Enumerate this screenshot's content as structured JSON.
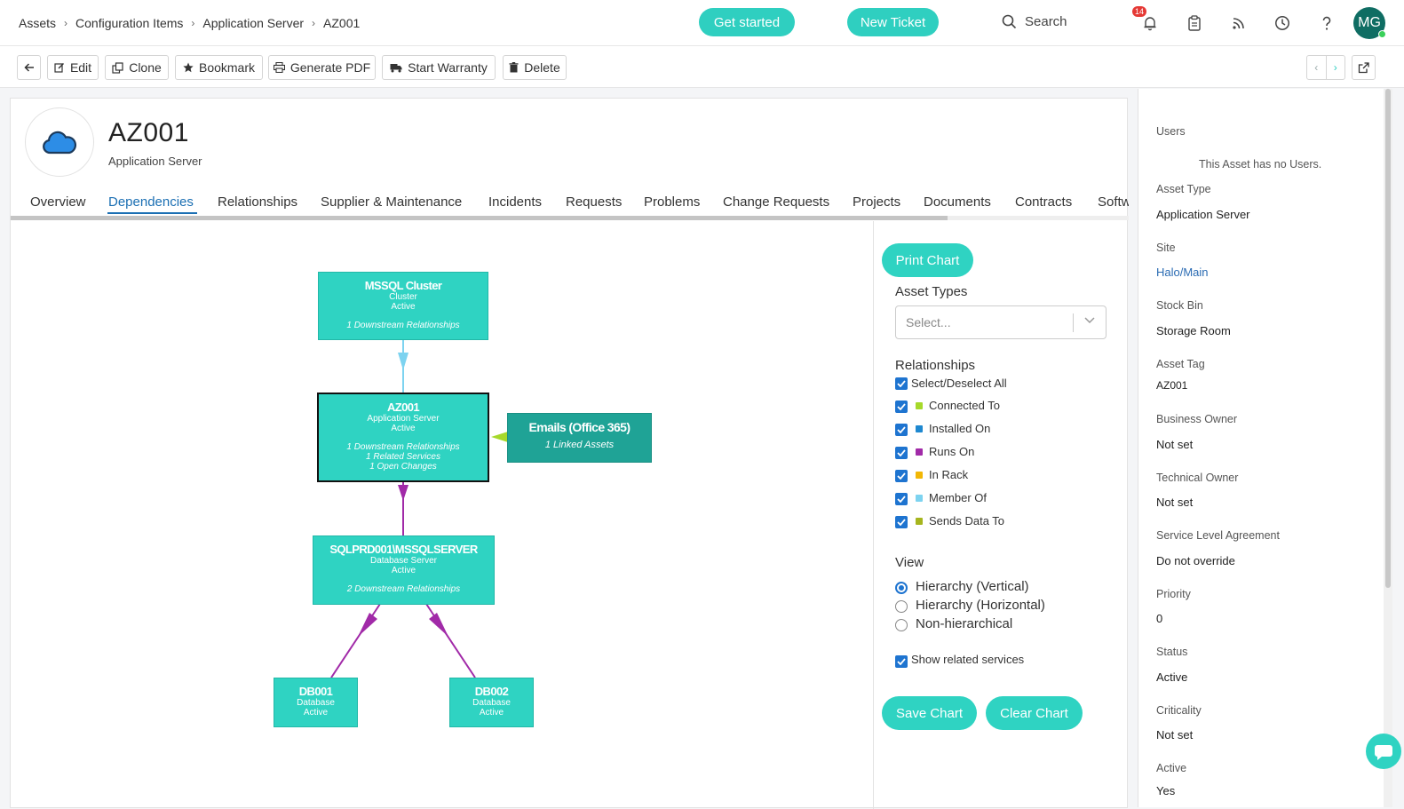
{
  "breadcrumb": [
    "Assets",
    "Configuration Items",
    "Application Server",
    "AZ001"
  ],
  "header": {
    "get_started": "Get started",
    "new_ticket": "New Ticket",
    "search_label": "Search",
    "notification_count": "14",
    "avatar_initials": "MG"
  },
  "toolbar": {
    "edit": "Edit",
    "clone": "Clone",
    "bookmark": "Bookmark",
    "generate_pdf": "Generate PDF",
    "start_warranty": "Start Warranty",
    "delete": "Delete"
  },
  "asset": {
    "name": "AZ001",
    "type": "Application Server"
  },
  "tabs": [
    "Overview",
    "Dependencies",
    "Relationships",
    "Supplier & Maintenance",
    "Incidents",
    "Requests",
    "Problems",
    "Change Requests",
    "Projects",
    "Documents",
    "Contracts",
    "Softw"
  ],
  "active_tab": "Dependencies",
  "graph": {
    "nodes": {
      "mssql": {
        "title": "MSSQL Cluster",
        "type": "Cluster",
        "status": "Active",
        "info": [
          "1 Downstream Relationships"
        ]
      },
      "az001": {
        "title": "AZ001",
        "type": "Application Server",
        "status": "Active",
        "info": [
          "1 Downstream Relationships",
          "1 Related Services",
          "1 Open Changes"
        ]
      },
      "emails": {
        "title": "Emails (Office 365)",
        "info": [
          "1 Linked Assets"
        ]
      },
      "sqlprd": {
        "title": "SQLPRD001\\MSSQLSERVER",
        "type": "Database Server",
        "status": "Active",
        "info": [
          "2 Downstream Relationships"
        ]
      },
      "db001": {
        "title": "DB001",
        "type": "Database",
        "status": "Active"
      },
      "db002": {
        "title": "DB002",
        "type": "Database",
        "status": "Active"
      }
    },
    "edge_colors": {
      "member_of": "#7dd3f0",
      "runs_on": "#a12aa8",
      "service_link": "#a6d92a"
    }
  },
  "controls": {
    "print_chart": "Print Chart",
    "asset_types_label": "Asset Types",
    "asset_types_placeholder": "Select...",
    "relationships_label": "Relationships",
    "select_all": "Select/Deselect All",
    "relationships": [
      {
        "label": "Connected To",
        "color": "#a6d92a"
      },
      {
        "label": "Installed On",
        "color": "#1e88d0"
      },
      {
        "label": "Runs On",
        "color": "#a12aa8"
      },
      {
        "label": "In Rack",
        "color": "#f2b705"
      },
      {
        "label": "Member Of",
        "color": "#7dd3f0"
      },
      {
        "label": "Sends Data To",
        "color": "#a6b51e"
      }
    ],
    "view_label": "View",
    "views": [
      "Hierarchy (Vertical)",
      "Hierarchy (Horizontal)",
      "Non-hierarchical"
    ],
    "selected_view": "Hierarchy (Vertical)",
    "show_related_services": "Show related services",
    "save_chart": "Save Chart",
    "clear_chart": "Clear Chart"
  },
  "sidebar": {
    "users_label": "Users",
    "users_empty": "This Asset has no Users.",
    "fields": [
      {
        "label": "Asset Type",
        "value": "Application Server"
      },
      {
        "label": "Site",
        "value": "Halo/Main"
      },
      {
        "label": "Stock Bin",
        "value": "Storage Room"
      },
      {
        "label": "Asset Tag",
        "value": "AZ001"
      },
      {
        "label": "Business Owner",
        "value": "Not set"
      },
      {
        "label": "Technical Owner",
        "value": "Not set"
      },
      {
        "label": "Service Level Agreement",
        "value": "Do not override"
      },
      {
        "label": "Priority",
        "value": "0"
      },
      {
        "label": "Status",
        "value": "Active"
      },
      {
        "label": "Criticality",
        "value": "Not set"
      },
      {
        "label": "Active",
        "value": "Yes"
      }
    ]
  },
  "colors": {
    "accent": "#2fcfc0",
    "link": "#1b6fb3",
    "checkbox": "#1e74d0"
  }
}
